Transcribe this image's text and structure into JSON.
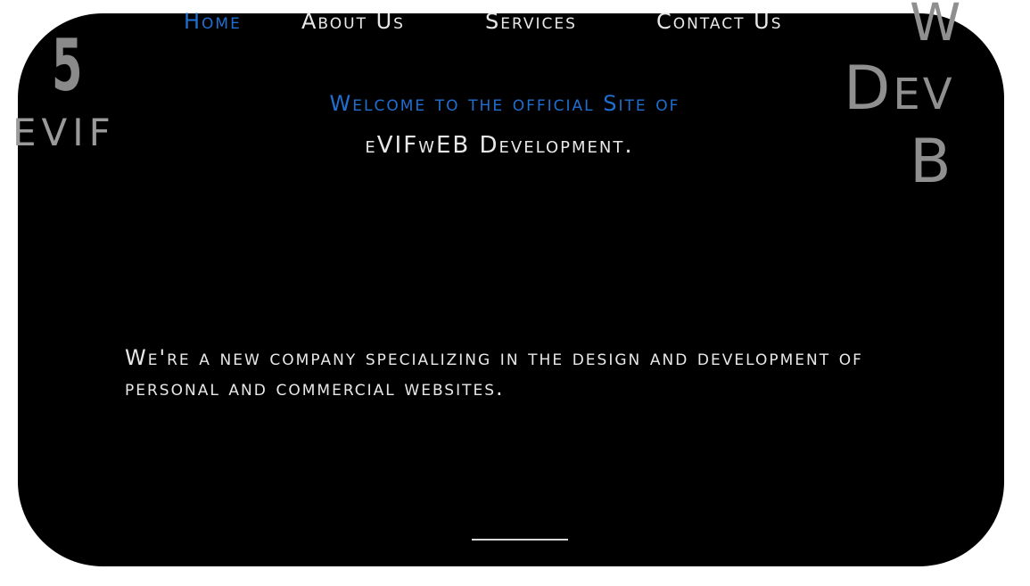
{
  "nav": {
    "items": [
      {
        "label": "Home",
        "active": true
      },
      {
        "label": "About Us",
        "active": false
      },
      {
        "label": "Services",
        "active": false
      },
      {
        "label": "Contact Us",
        "active": false
      }
    ]
  },
  "logo_left": {
    "digit": "5",
    "text": "EVIF"
  },
  "logo_right": {
    "line1": "W",
    "line2": "Dev",
    "line3": "B"
  },
  "hero": {
    "welcome": "Welcome to the official Site of",
    "company": "eVIFwEB Development."
  },
  "intro": {
    "tagline": "We're a new company specializing in the design and development of personal and commercial websites."
  },
  "colors": {
    "background": "#000000",
    "accent": "#1f6fd1",
    "text": "#e8e8e8",
    "logo": "#8f8f8f"
  }
}
